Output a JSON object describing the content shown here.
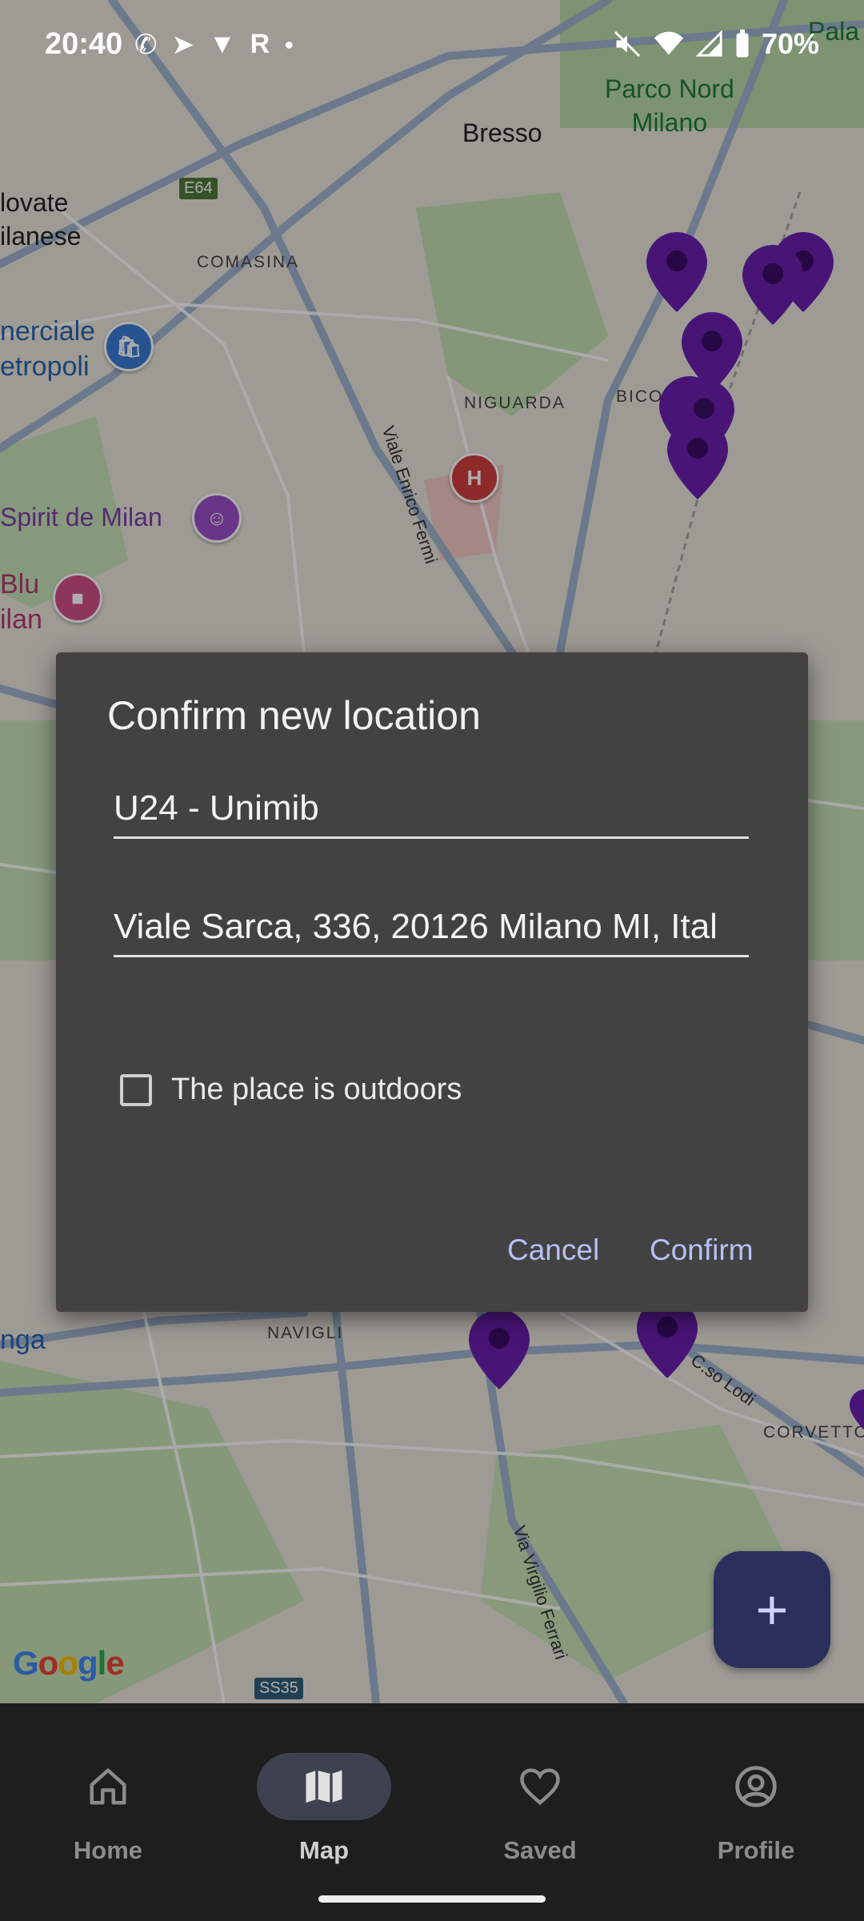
{
  "status_bar": {
    "time": "20:40",
    "battery": "70%",
    "left_icons": [
      "whatsapp-icon",
      "telegram-icon",
      "vpn-icon",
      "r-icon",
      "dot-icon"
    ],
    "right_icons": [
      "mute-icon",
      "wifi-icon",
      "signal-icon",
      "battery-icon"
    ]
  },
  "map": {
    "labels": {
      "bresso": "Bresso",
      "parco_nord": "Parco Nord\nMilano",
      "novate": "lovate\nilanese",
      "comasina": "COMASINA",
      "niguarda": "NIGUARDA",
      "bico": "BICO",
      "commerciale": "nerciale\netropoli",
      "spirit": "Spirit de Milan",
      "blu": "Blu\nilan",
      "navigli": "NAVIGLI",
      "corvetto": "CORVETTO",
      "nga": "nga",
      "pala": "Pala",
      "viale_fermi": "Viale Enrico Fermi",
      "via_ferrari": "Via Virgilio Ferrari",
      "corso_lodi": "C.so Lodi",
      "e64": "E64",
      "ss35": "SS35",
      "hospital": "H"
    },
    "google_logo": "Google",
    "pin_color": "#6a1fb0"
  },
  "dialog": {
    "title": "Confirm new location",
    "name_value": "U24 - Unimib",
    "address_value": "Viale Sarca, 336, 20126 Milano MI, Ital",
    "outdoors_label": "The place is outdoors",
    "outdoors_checked": false,
    "cancel_label": "Cancel",
    "confirm_label": "Confirm"
  },
  "fab": {
    "label": "+"
  },
  "bottom_nav": {
    "items": [
      {
        "label": "Home",
        "icon": "home-icon"
      },
      {
        "label": "Map",
        "icon": "map-icon",
        "active": true
      },
      {
        "label": "Saved",
        "icon": "heart-icon"
      },
      {
        "label": "Profile",
        "icon": "profile-icon"
      }
    ]
  }
}
